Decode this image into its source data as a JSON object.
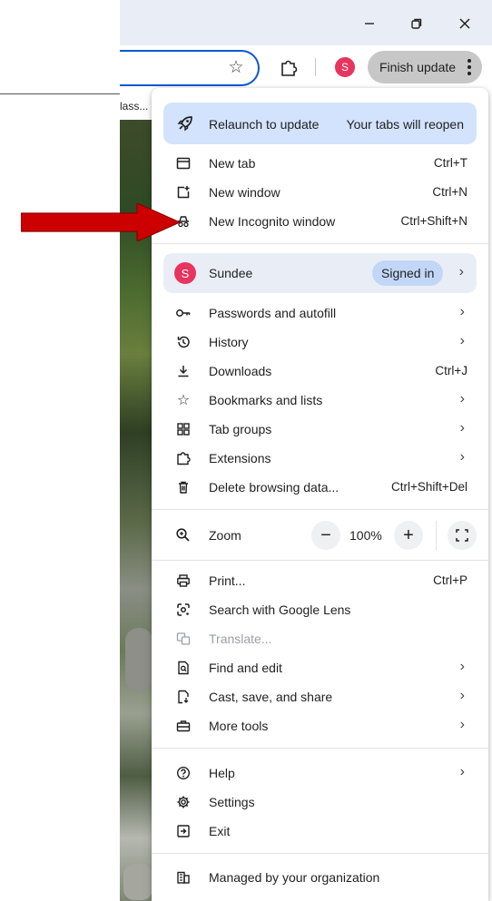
{
  "toolbar": {
    "finish_update": "Finish update",
    "avatar_letter": "S",
    "bookmark_snippet": "lass..."
  },
  "menu": {
    "relaunch": {
      "label": "Relaunch to update",
      "note": "Your tabs will reopen"
    },
    "new_tab": {
      "label": "New tab",
      "shortcut": "Ctrl+T"
    },
    "new_window": {
      "label": "New window",
      "shortcut": "Ctrl+N"
    },
    "new_incognito": {
      "label": "New Incognito window",
      "shortcut": "Ctrl+Shift+N"
    },
    "profile": {
      "initial": "S",
      "name": "Sundee",
      "status": "Signed in"
    },
    "passwords": {
      "label": "Passwords and autofill"
    },
    "history": {
      "label": "History"
    },
    "downloads": {
      "label": "Downloads",
      "shortcut": "Ctrl+J"
    },
    "bookmarks": {
      "label": "Bookmarks and lists"
    },
    "tab_groups": {
      "label": "Tab groups"
    },
    "extensions": {
      "label": "Extensions"
    },
    "delete_data": {
      "label": "Delete browsing data...",
      "shortcut": "Ctrl+Shift+Del"
    },
    "zoom": {
      "label": "Zoom",
      "value": "100%",
      "minus": "−",
      "plus": "+"
    },
    "print": {
      "label": "Print...",
      "shortcut": "Ctrl+P"
    },
    "lens": {
      "label": "Search with Google Lens"
    },
    "translate": {
      "label": "Translate..."
    },
    "find_edit": {
      "label": "Find and edit"
    },
    "cast_save": {
      "label": "Cast, save, and share"
    },
    "more_tools": {
      "label": "More tools"
    },
    "help": {
      "label": "Help"
    },
    "settings": {
      "label": "Settings"
    },
    "exit": {
      "label": "Exit"
    },
    "managed": {
      "label": "Managed by your organization"
    }
  },
  "colors": {
    "accent": "#0b57d0",
    "relaunch_bg": "#d3e3fd",
    "avatar": "#e8345f",
    "arrow": "#cc0000"
  }
}
